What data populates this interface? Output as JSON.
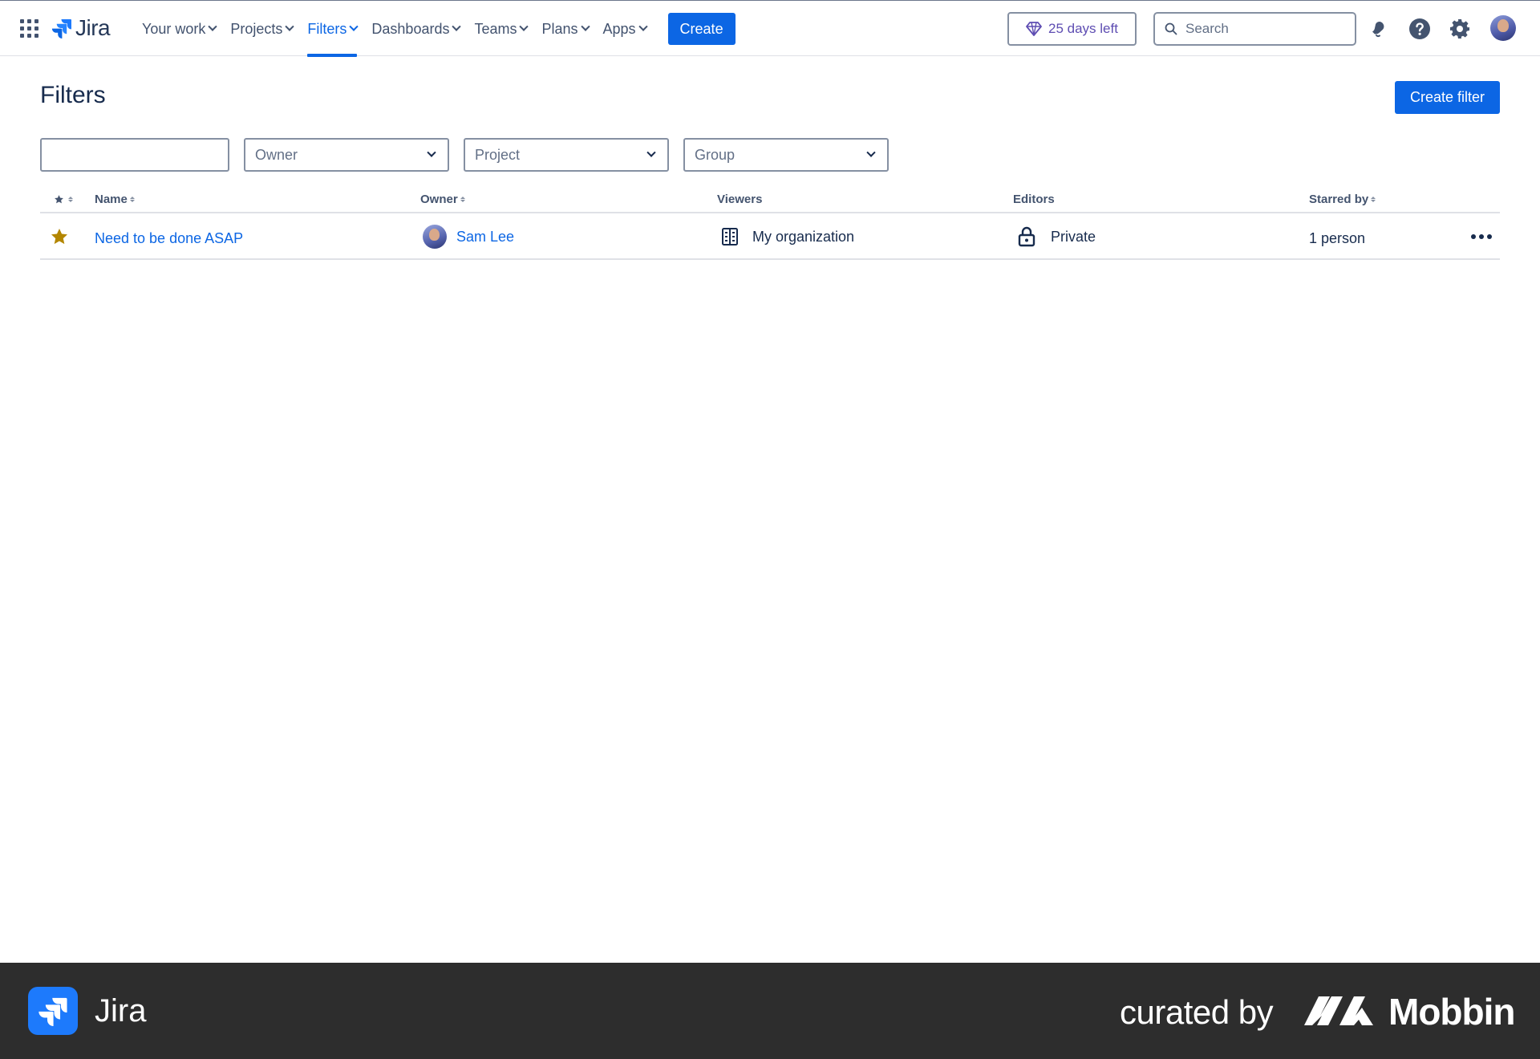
{
  "app": {
    "name": "Jira"
  },
  "nav": {
    "items": [
      {
        "label": "Your work",
        "active": false
      },
      {
        "label": "Projects",
        "active": false
      },
      {
        "label": "Filters",
        "active": true
      },
      {
        "label": "Dashboards",
        "active": false
      },
      {
        "label": "Teams",
        "active": false
      },
      {
        "label": "Plans",
        "active": false
      },
      {
        "label": "Apps",
        "active": false
      }
    ],
    "create_label": "Create",
    "trial_label": "25 days left",
    "search_placeholder": "Search"
  },
  "page": {
    "title": "Filters",
    "create_filter_label": "Create filter"
  },
  "filters": {
    "search_value": "",
    "owner_placeholder": "Owner",
    "project_placeholder": "Project",
    "group_placeholder": "Group"
  },
  "table": {
    "headers": {
      "name": "Name",
      "owner": "Owner",
      "viewers": "Viewers",
      "editors": "Editors",
      "starred_by": "Starred by"
    },
    "rows": [
      {
        "starred": true,
        "name": "Need to be done ASAP",
        "owner": "Sam Lee",
        "viewers": "My organization",
        "editors": "Private",
        "starred_by": "1 person"
      }
    ]
  },
  "footer": {
    "app_name": "Jira",
    "curated_by": "curated by",
    "brand": "Mobbin"
  },
  "colors": {
    "accent": "#0c66e4",
    "star": "#b38600",
    "trial": "#5e4db2",
    "footer_bg": "#2d2d2d"
  }
}
